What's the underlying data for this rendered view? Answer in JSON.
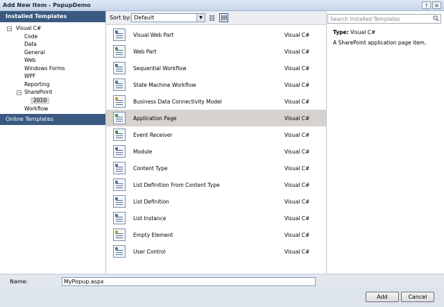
{
  "window": {
    "title": "Add New Item - PopupDemo",
    "help_glyph": "?",
    "close_glyph": "✕"
  },
  "left_panel": {
    "header": "Installed Templates",
    "tree": [
      {
        "label": "Visual C#",
        "expander": "−"
      },
      {
        "label": "Code"
      },
      {
        "label": "Data"
      },
      {
        "label": "General"
      },
      {
        "label": "Web"
      },
      {
        "label": "Windows Forms"
      },
      {
        "label": "WPF"
      },
      {
        "label": "Reporting"
      },
      {
        "label": "SharePoint",
        "expander": "−"
      },
      {
        "label": "2010",
        "selected": true
      },
      {
        "label": "Workflow"
      }
    ],
    "online_templates": "Online Templates"
  },
  "toolbar": {
    "sort_label": "Sort by:",
    "sort_value": "Default",
    "dropdown_glyph": "▼"
  },
  "templates": [
    {
      "name": "Visual Web Part",
      "lang": "Visual C#",
      "accent": "#3b6fb6"
    },
    {
      "name": "Web Part",
      "lang": "Visual C#",
      "accent": "#3a9a3a"
    },
    {
      "name": "Sequential Workflow",
      "lang": "Visual C#",
      "accent": "#4a74b0"
    },
    {
      "name": "State Machine Workflow",
      "lang": "Visual C#",
      "accent": "#4a74b0"
    },
    {
      "name": "Business Data Connectivity Model",
      "lang": "Visual C#",
      "accent": "#c99a1f"
    },
    {
      "name": "Application Page",
      "lang": "Visual C#",
      "accent": "#3a9a3a",
      "selected": true
    },
    {
      "name": "Event Receiver",
      "lang": "Visual C#",
      "accent": "#3a9a3a"
    },
    {
      "name": "Module",
      "lang": "Visual C#",
      "accent": "#4a74b0"
    },
    {
      "name": "Content Type",
      "lang": "Visual C#",
      "accent": "#4a74b0"
    },
    {
      "name": "List Definition From Content Type",
      "lang": "Visual C#",
      "accent": "#4a74b0"
    },
    {
      "name": "List Definition",
      "lang": "Visual C#",
      "accent": "#4a74b0"
    },
    {
      "name": "List Instance",
      "lang": "Visual C#",
      "accent": "#4a74b0"
    },
    {
      "name": "Empty Element",
      "lang": "Visual C#",
      "accent": "#c99a1f"
    },
    {
      "name": "User Control",
      "lang": "Visual C#",
      "accent": "#4a74b0"
    }
  ],
  "details": {
    "search_placeholder": "Search Installed Templates",
    "type_label": "Type:",
    "type_value": "Visual C#",
    "description": "A SharePoint application page item."
  },
  "name_field": {
    "label": "Name:",
    "value": "MyPopup.aspx"
  },
  "buttons": {
    "add": "Add",
    "cancel": "Cancel"
  },
  "colors": {
    "header_bg": "#3b5a82",
    "selected_row": "#d6d3ce"
  }
}
